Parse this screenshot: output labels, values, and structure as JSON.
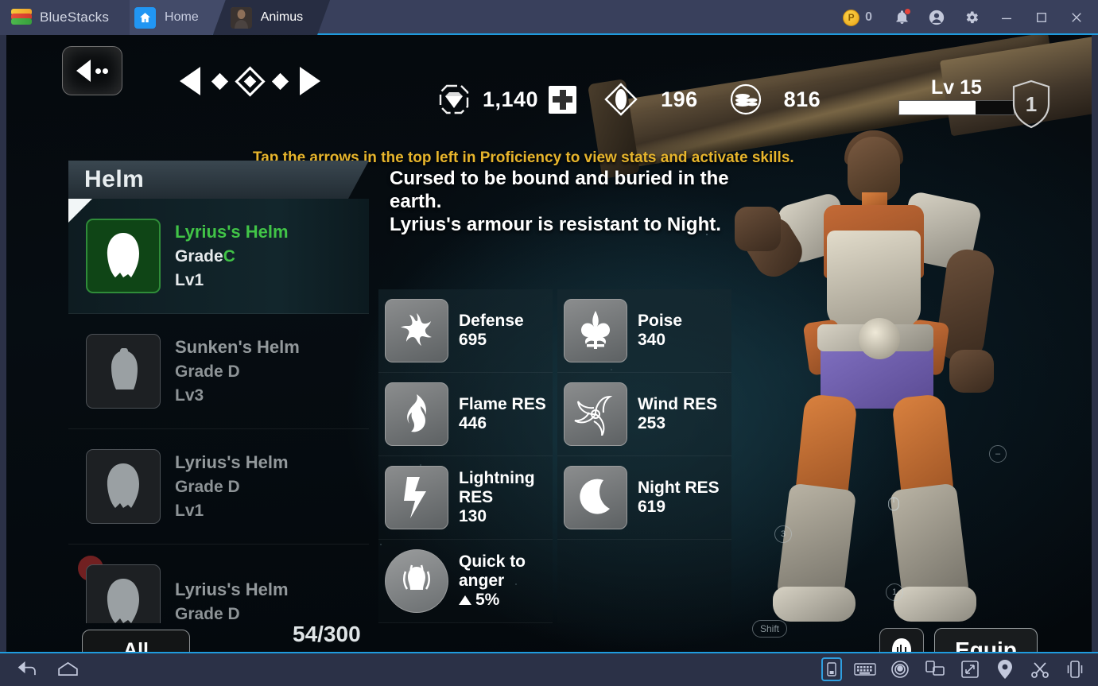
{
  "window": {
    "brand": "BlueStacks",
    "tabs": [
      {
        "label": "Home",
        "icon": "home-icon",
        "active": false
      },
      {
        "label": "Animus",
        "icon": "game-thumb-icon",
        "active": true
      }
    ],
    "points_value": "0",
    "controls": {
      "points_icon": "bluestacks-points-icon",
      "notifications_icon": "bell-icon",
      "account_icon": "account-icon",
      "settings_icon": "gear-icon",
      "minimize_icon": "minimize-icon",
      "maximize_icon": "maximize-icon",
      "close_icon": "close-icon"
    }
  },
  "game": {
    "back_button": "back-button",
    "proficiency_nav": [
      "arrow-left-icon",
      "diamond-small-icon",
      "diamond-large-icon",
      "diamond-small-icon",
      "arrow-right-icon"
    ],
    "tip": "Tap the arrows in the top left in Proficiency to view stats and activate skills.",
    "currencies": [
      {
        "icon": "gem-icon",
        "value": "1,140"
      },
      {
        "icon": "health-plus-icon",
        "value": ""
      },
      {
        "icon": "soul-diamond-icon",
        "value": "196"
      },
      {
        "icon": "coins-icon",
        "value": "816"
      }
    ],
    "level": {
      "label": "Lv 15",
      "progress_percent": 67
    },
    "shield_badge": "1",
    "panel": {
      "title": "Helm",
      "items": [
        {
          "name": "Lyrius's Helm",
          "grade_label": "Grade",
          "grade": "C",
          "level": "Lv1",
          "rarity": "rare",
          "selected": true,
          "marker": false
        },
        {
          "name": "Sunken's Helm",
          "grade_label": "Grade",
          "grade": "D",
          "level": "Lv3",
          "rarity": "common",
          "selected": false,
          "marker": false
        },
        {
          "name": "Lyrius's Helm",
          "grade_label": "Grade",
          "grade": "D",
          "level": "Lv1",
          "rarity": "common",
          "selected": false,
          "marker": false
        },
        {
          "name": "Lyrius's Helm",
          "grade_label": "Grade",
          "grade": "D",
          "level": "",
          "rarity": "common",
          "selected": false,
          "marker": true
        }
      ]
    },
    "description": "Cursed to be bound and buried in the earth.\nLyrius's armour is resistant to Night.",
    "stats_left": [
      {
        "icon": "defense-icon",
        "name": "Defense",
        "value": "695"
      },
      {
        "icon": "flame-icon",
        "name": "Flame RES",
        "value": "446"
      },
      {
        "icon": "lightning-icon",
        "name": "Lightning RES",
        "value": "130"
      },
      {
        "icon": "rage-icon",
        "name": "Quick to anger",
        "value": "5%",
        "has_up_arrow": true
      }
    ],
    "stats_right": [
      {
        "icon": "fleur-de-lis-icon",
        "name": "Poise",
        "value": "340"
      },
      {
        "icon": "wind-spiral-icon",
        "name": "Wind RES",
        "value": "253"
      },
      {
        "icon": "moon-icon",
        "name": "Night RES",
        "value": "619"
      }
    ],
    "filter_button": "All",
    "item_count": "54/300",
    "equip_button": "Equip",
    "helm_slot_icon": "helmet-icon",
    "keymap_hints": [
      {
        "label": "Shift",
        "type": "pill"
      },
      {
        "label": "3",
        "type": "circle"
      },
      {
        "label": "1",
        "type": "circle"
      },
      {
        "label": "",
        "type": "mouse"
      }
    ]
  },
  "bottom_bar": {
    "left": [
      "back-icon",
      "home-icon"
    ],
    "right": [
      "multi-instance-icon",
      "keyboard-icon",
      "eye-icon",
      "rotate-icon",
      "fullscreen-icon",
      "location-icon",
      "scissors-icon",
      "shake-icon"
    ]
  },
  "colors": {
    "accent": "#1f9bde",
    "tip": "#e7b52c",
    "rare": "#41c447",
    "chrome": "#39405c",
    "bottom": "#2b3147"
  }
}
